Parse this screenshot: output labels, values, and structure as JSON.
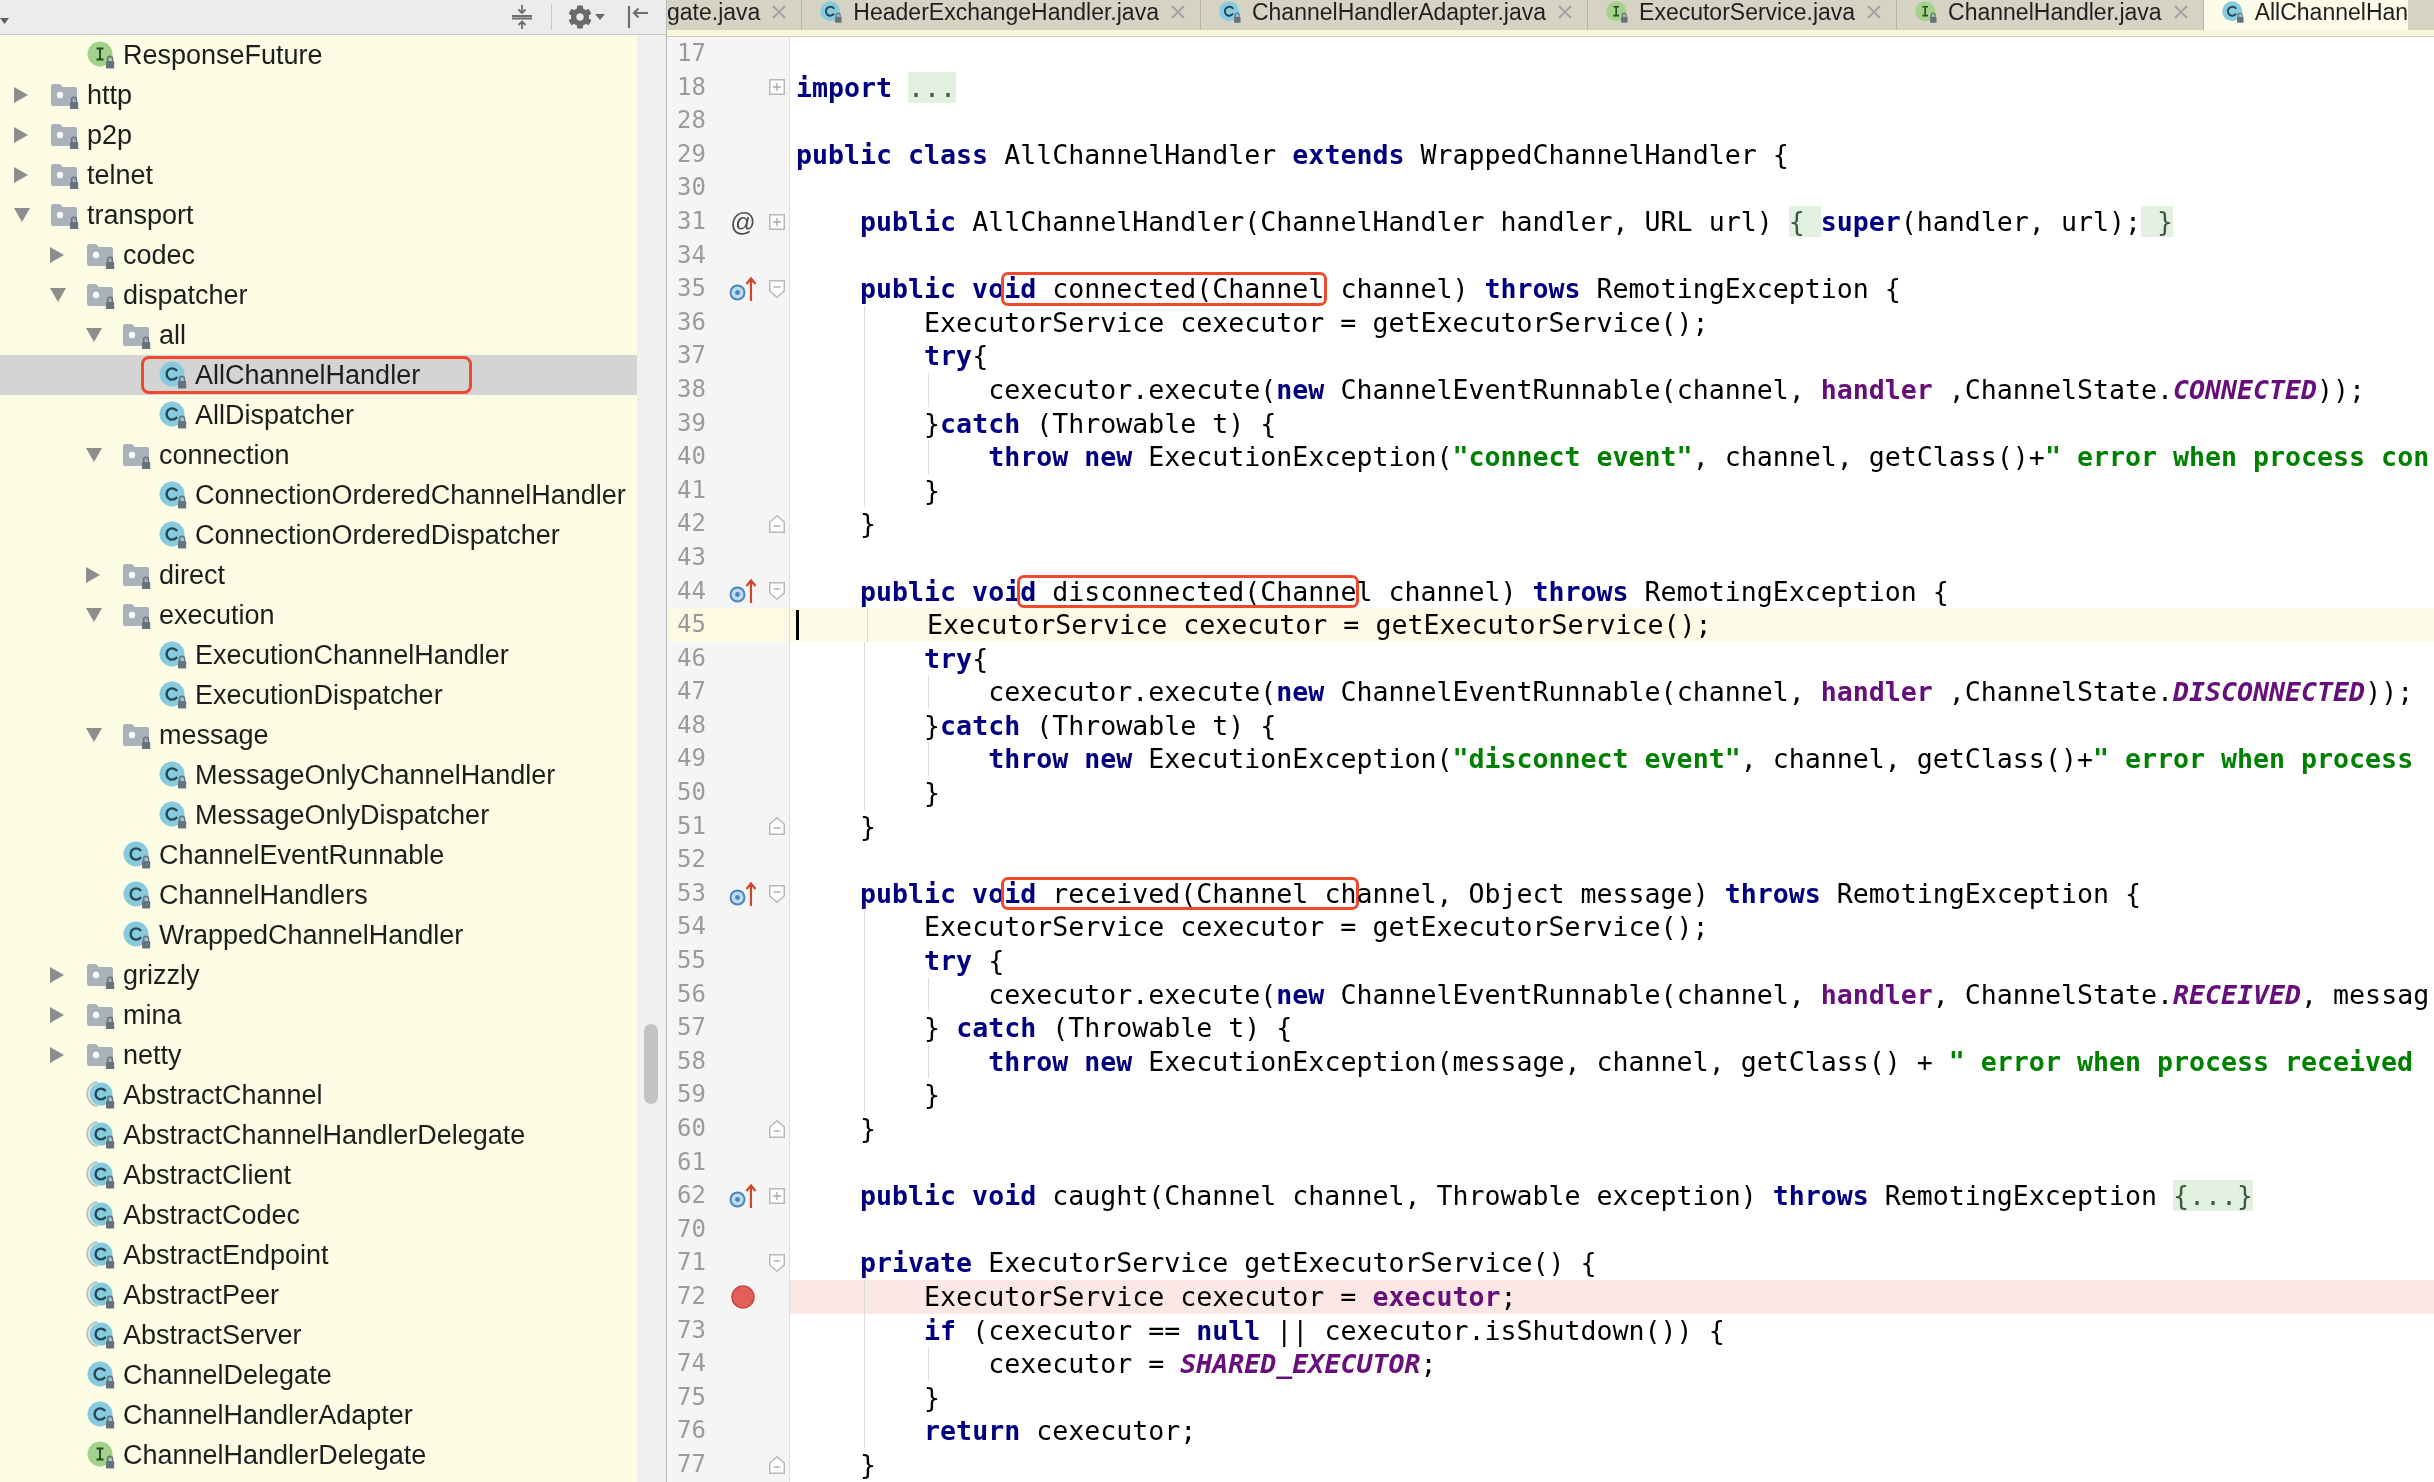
{
  "sidebar": {
    "tree": [
      {
        "children": [
          {
            "label": "ResponseFuture",
            "kind": "interface",
            "selected": false,
            "callout": false
          }
        ]
      },
      {
        "label": "http",
        "kind": "package",
        "expanded": false,
        "selected": false,
        "callout": false
      },
      {
        "label": "p2p",
        "kind": "package",
        "expanded": false,
        "selected": false,
        "callout": false
      },
      {
        "label": "telnet",
        "kind": "package",
        "expanded": false,
        "selected": false,
        "callout": false
      },
      {
        "label": "transport",
        "kind": "package",
        "expanded": true,
        "selected": false,
        "callout": false,
        "children": [
          {
            "label": "codec",
            "kind": "package",
            "expanded": false,
            "selected": false,
            "callout": false
          },
          {
            "label": "dispatcher",
            "kind": "package",
            "expanded": true,
            "selected": false,
            "callout": false,
            "children": [
              {
                "label": "all",
                "kind": "package",
                "expanded": true,
                "selected": false,
                "callout": false,
                "children": [
                  {
                    "label": "AllChannelHandler",
                    "kind": "class",
                    "selected": true,
                    "callout": true
                  },
                  {
                    "label": "AllDispatcher",
                    "kind": "class",
                    "selected": false,
                    "callout": false
                  }
                ]
              },
              {
                "label": "connection",
                "kind": "package",
                "expanded": true,
                "selected": false,
                "callout": false,
                "children": [
                  {
                    "label": "ConnectionOrderedChannelHandler",
                    "kind": "class",
                    "selected": false,
                    "callout": false
                  },
                  {
                    "label": "ConnectionOrderedDispatcher",
                    "kind": "class",
                    "selected": false,
                    "callout": false
                  }
                ]
              },
              {
                "label": "direct",
                "kind": "package",
                "expanded": false,
                "selected": false,
                "callout": false
              },
              {
                "label": "execution",
                "kind": "package",
                "expanded": true,
                "selected": false,
                "callout": false,
                "children": [
                  {
                    "label": "ExecutionChannelHandler",
                    "kind": "class",
                    "selected": false,
                    "callout": false
                  },
                  {
                    "label": "ExecutionDispatcher",
                    "kind": "class",
                    "selected": false,
                    "callout": false
                  }
                ]
              },
              {
                "label": "message",
                "kind": "package",
                "expanded": true,
                "selected": false,
                "callout": false,
                "children": [
                  {
                    "label": "MessageOnlyChannelHandler",
                    "kind": "class",
                    "selected": false,
                    "callout": false
                  },
                  {
                    "label": "MessageOnlyDispatcher",
                    "kind": "class",
                    "selected": false,
                    "callout": false
                  }
                ]
              },
              {
                "label": "ChannelEventRunnable",
                "kind": "class",
                "selected": false,
                "callout": false
              },
              {
                "label": "ChannelHandlers",
                "kind": "class",
                "selected": false,
                "callout": false
              },
              {
                "label": "WrappedChannelHandler",
                "kind": "class",
                "selected": false,
                "callout": false
              }
            ]
          },
          {
            "label": "grizzly",
            "kind": "package",
            "expanded": false,
            "selected": false,
            "callout": false
          },
          {
            "label": "mina",
            "kind": "package",
            "expanded": false,
            "selected": false,
            "callout": false
          },
          {
            "label": "netty",
            "kind": "package",
            "expanded": false,
            "selected": false,
            "callout": false
          },
          {
            "label": "AbstractChannel",
            "kind": "abstract_class",
            "selected": false,
            "callout": false
          },
          {
            "label": "AbstractChannelHandlerDelegate",
            "kind": "abstract_class",
            "selected": false,
            "callout": false
          },
          {
            "label": "AbstractClient",
            "kind": "abstract_class",
            "selected": false,
            "callout": false
          },
          {
            "label": "AbstractCodec",
            "kind": "abstract_class",
            "selected": false,
            "callout": false
          },
          {
            "label": "AbstractEndpoint",
            "kind": "abstract_class",
            "selected": false,
            "callout": false
          },
          {
            "label": "AbstractPeer",
            "kind": "abstract_class",
            "selected": false,
            "callout": false
          },
          {
            "label": "AbstractServer",
            "kind": "abstract_class",
            "selected": false,
            "callout": false
          },
          {
            "label": "ChannelDelegate",
            "kind": "class",
            "selected": false,
            "callout": false
          },
          {
            "label": "ChannelHandlerAdapter",
            "kind": "class",
            "selected": false,
            "callout": false
          },
          {
            "label": "ChannelHandlerDelegate",
            "kind": "interface",
            "selected": false,
            "callout": false
          }
        ]
      }
    ]
  },
  "editor": {
    "tabs": [
      {
        "label": "gate.java",
        "kind": "plain",
        "selected": false,
        "closable": true
      },
      {
        "label": "HeaderExchangeHandler.java",
        "kind": "class",
        "selected": false,
        "closable": true
      },
      {
        "label": "ChannelHandlerAdapter.java",
        "kind": "class",
        "selected": false,
        "closable": true
      },
      {
        "label": "ExecutorService.java",
        "kind": "interface",
        "selected": false,
        "closable": true
      },
      {
        "label": "ChannelHandler.java",
        "kind": "interface",
        "selected": false,
        "closable": true
      },
      {
        "label": "AllChannelHan",
        "kind": "class",
        "selected": true,
        "closable": false
      }
    ],
    "lines": [
      {
        "number": "17",
        "kind": "plain"
      },
      {
        "number": "18",
        "kind": "plain",
        "fold": {
          "kind": "collapsed"
        },
        "tokens": [
          {
            "text": "import ",
            "kind": "keyword"
          },
          {
            "text": "...",
            "kind": "fold"
          }
        ]
      },
      {
        "number": "28",
        "kind": "plain"
      },
      {
        "number": "29",
        "kind": "plain",
        "tokens": [
          {
            "text": "public class",
            "kind": "keyword"
          },
          {
            "text": " AllChannelHandler ",
            "kind": "plain"
          },
          {
            "text": "extends",
            "kind": "keyword"
          },
          {
            "text": " WrappedChannelHandler {",
            "kind": "plain"
          }
        ]
      },
      {
        "number": "30",
        "kind": "plain"
      },
      {
        "number": "31",
        "kind": "plain",
        "marker": {
          "kind": "glyph",
          "text": "@"
        },
        "fold": {
          "kind": "collapsed"
        },
        "tokens": [
          {
            "text": "    public",
            "kind": "keyword"
          },
          {
            "text": " AllChannelHandler(ChannelHandler handler, URL url) ",
            "kind": "plain"
          },
          {
            "text": "{ ",
            "kind": "fold"
          },
          {
            "text": "super",
            "kind": "keyword"
          },
          {
            "text": "(handler, url);",
            "kind": "plain"
          },
          {
            "text": " }",
            "kind": "fold"
          }
        ]
      },
      {
        "number": "34",
        "kind": "plain"
      },
      {
        "number": "35",
        "kind": "plain",
        "marker": {
          "kind": "override"
        },
        "fold": {
          "kind": "start"
        },
        "tokens": [
          {
            "text": "    public vo",
            "kind": "keyword"
          },
          {
            "kind": "callout",
            "parts": [
              {
                "text": "id",
                "kind": "keyword"
              },
              {
                "text": " connected(Channel",
                "kind": "plain"
              }
            ]
          },
          {
            "text": " channel) ",
            "kind": "plain"
          },
          {
            "text": "throws",
            "kind": "keyword"
          },
          {
            "text": " RemotingException {",
            "kind": "plain"
          }
        ]
      },
      {
        "number": "36",
        "kind": "plain",
        "tokens": [
          {
            "text": "        ExecutorService cexecutor = getExecutorService();",
            "kind": "plain"
          }
        ]
      },
      {
        "number": "37",
        "kind": "plain",
        "tokens": [
          {
            "text": "        try",
            "kind": "keyword"
          },
          {
            "text": "{",
            "kind": "plain"
          }
        ]
      },
      {
        "number": "38",
        "kind": "plain",
        "tokens": [
          {
            "text": "            cexecutor.execute(",
            "kind": "plain"
          },
          {
            "text": "new",
            "kind": "keyword"
          },
          {
            "text": " ChannelEventRunnable(channel, ",
            "kind": "plain"
          },
          {
            "text": "handler",
            "kind": "field"
          },
          {
            "text": " ,ChannelState.",
            "kind": "plain"
          },
          {
            "text": "CONNECTED",
            "kind": "constant"
          },
          {
            "text": "));",
            "kind": "plain"
          }
        ]
      },
      {
        "number": "39",
        "kind": "plain",
        "tokens": [
          {
            "text": "        }",
            "kind": "plain"
          },
          {
            "text": "catch",
            "kind": "keyword"
          },
          {
            "text": " (Throwable t) {",
            "kind": "plain"
          }
        ]
      },
      {
        "number": "40",
        "kind": "plain",
        "tokens": [
          {
            "text": "            throw new",
            "kind": "keyword"
          },
          {
            "text": " ExecutionException(",
            "kind": "plain"
          },
          {
            "text": "\"connect event\"",
            "kind": "string"
          },
          {
            "text": ", channel, getClass()+",
            "kind": "plain"
          },
          {
            "text": "\" error when process con",
            "kind": "string"
          }
        ]
      },
      {
        "number": "41",
        "kind": "plain",
        "tokens": [
          {
            "text": "        }",
            "kind": "plain"
          }
        ]
      },
      {
        "number": "42",
        "kind": "plain",
        "fold": {
          "kind": "end"
        },
        "tokens": [
          {
            "text": "    }",
            "kind": "plain"
          }
        ]
      },
      {
        "number": "43",
        "kind": "plain"
      },
      {
        "number": "44",
        "kind": "plain",
        "marker": {
          "kind": "override"
        },
        "fold": {
          "kind": "start"
        },
        "tokens": [
          {
            "text": "    public voi",
            "kind": "keyword"
          },
          {
            "kind": "callout",
            "parts": [
              {
                "text": "d",
                "kind": "keyword"
              },
              {
                "text": " disconnected(Channe",
                "kind": "plain"
              }
            ]
          },
          {
            "text": "l channel) ",
            "kind": "plain"
          },
          {
            "text": "throws",
            "kind": "keyword"
          },
          {
            "text": " RemotingException {",
            "kind": "plain"
          }
        ]
      },
      {
        "number": "45",
        "kind": "current",
        "tokens": [
          {
            "text": "        ExecutorService cexecutor = getExecutorService();",
            "kind": "plain"
          }
        ]
      },
      {
        "number": "46",
        "kind": "plain",
        "tokens": [
          {
            "text": "        try",
            "kind": "keyword"
          },
          {
            "text": "{",
            "kind": "plain"
          }
        ]
      },
      {
        "number": "47",
        "kind": "plain",
        "tokens": [
          {
            "text": "            cexecutor.execute(",
            "kind": "plain"
          },
          {
            "text": "new",
            "kind": "keyword"
          },
          {
            "text": " ChannelEventRunnable(channel, ",
            "kind": "plain"
          },
          {
            "text": "handler",
            "kind": "field"
          },
          {
            "text": " ,ChannelState.",
            "kind": "plain"
          },
          {
            "text": "DISCONNECTED",
            "kind": "constant"
          },
          {
            "text": "));",
            "kind": "plain"
          }
        ]
      },
      {
        "number": "48",
        "kind": "plain",
        "tokens": [
          {
            "text": "        }",
            "kind": "plain"
          },
          {
            "text": "catch",
            "kind": "keyword"
          },
          {
            "text": " (Throwable t) {",
            "kind": "plain"
          }
        ]
      },
      {
        "number": "49",
        "kind": "plain",
        "tokens": [
          {
            "text": "            throw new",
            "kind": "keyword"
          },
          {
            "text": " ExecutionException(",
            "kind": "plain"
          },
          {
            "text": "\"disconnect event\"",
            "kind": "string"
          },
          {
            "text": ", channel, getClass()+",
            "kind": "plain"
          },
          {
            "text": "\" error when process",
            "kind": "string"
          }
        ]
      },
      {
        "number": "50",
        "kind": "plain",
        "tokens": [
          {
            "text": "        }",
            "kind": "plain"
          }
        ]
      },
      {
        "number": "51",
        "kind": "plain",
        "fold": {
          "kind": "end"
        },
        "tokens": [
          {
            "text": "    }",
            "kind": "plain"
          }
        ]
      },
      {
        "number": "52",
        "kind": "plain"
      },
      {
        "number": "53",
        "kind": "plain",
        "marker": {
          "kind": "override"
        },
        "fold": {
          "kind": "start"
        },
        "tokens": [
          {
            "text": "    public vo",
            "kind": "keyword"
          },
          {
            "kind": "callout",
            "parts": [
              {
                "text": "id",
                "kind": "keyword"
              },
              {
                "text": " received(Channel ch",
                "kind": "plain"
              }
            ]
          },
          {
            "text": "annel, Object message) ",
            "kind": "plain"
          },
          {
            "text": "throws",
            "kind": "keyword"
          },
          {
            "text": " RemotingException {",
            "kind": "plain"
          }
        ]
      },
      {
        "number": "54",
        "kind": "plain",
        "tokens": [
          {
            "text": "        ExecutorService cexecutor = getExecutorService();",
            "kind": "plain"
          }
        ]
      },
      {
        "number": "55",
        "kind": "plain",
        "tokens": [
          {
            "text": "        try",
            "kind": "keyword"
          },
          {
            "text": " {",
            "kind": "plain"
          }
        ]
      },
      {
        "number": "56",
        "kind": "plain",
        "tokens": [
          {
            "text": "            cexecutor.execute(",
            "kind": "plain"
          },
          {
            "text": "new",
            "kind": "keyword"
          },
          {
            "text": " ChannelEventRunnable(channel, ",
            "kind": "plain"
          },
          {
            "text": "handler",
            "kind": "field"
          },
          {
            "text": ", ChannelState.",
            "kind": "plain"
          },
          {
            "text": "RECEIVED",
            "kind": "constant"
          },
          {
            "text": ", messag",
            "kind": "plain"
          }
        ]
      },
      {
        "number": "57",
        "kind": "plain",
        "tokens": [
          {
            "text": "        } ",
            "kind": "plain"
          },
          {
            "text": "catch",
            "kind": "keyword"
          },
          {
            "text": " (Throwable t) {",
            "kind": "plain"
          }
        ]
      },
      {
        "number": "58",
        "kind": "plain",
        "tokens": [
          {
            "text": "            throw new",
            "kind": "keyword"
          },
          {
            "text": " ExecutionException(message, channel, getClass() + ",
            "kind": "plain"
          },
          {
            "text": "\" error when process received",
            "kind": "string"
          }
        ]
      },
      {
        "number": "59",
        "kind": "plain",
        "tokens": [
          {
            "text": "        }",
            "kind": "plain"
          }
        ]
      },
      {
        "number": "60",
        "kind": "plain",
        "fold": {
          "kind": "end"
        },
        "tokens": [
          {
            "text": "    }",
            "kind": "plain"
          }
        ]
      },
      {
        "number": "61",
        "kind": "plain"
      },
      {
        "number": "62",
        "kind": "plain",
        "marker": {
          "kind": "override"
        },
        "fold": {
          "kind": "collapsed"
        },
        "tokens": [
          {
            "text": "    public void",
            "kind": "keyword"
          },
          {
            "text": " caught(Channel channel, Throwable exception) ",
            "kind": "plain"
          },
          {
            "text": "throws",
            "kind": "keyword"
          },
          {
            "text": " RemotingException ",
            "kind": "plain"
          },
          {
            "text": "{...}",
            "kind": "fold"
          }
        ]
      },
      {
        "number": "70",
        "kind": "plain"
      },
      {
        "number": "71",
        "kind": "plain",
        "fold": {
          "kind": "start"
        },
        "tokens": [
          {
            "text": "    private",
            "kind": "keyword"
          },
          {
            "text": " ExecutorService getExecutorService() {",
            "kind": "plain"
          }
        ]
      },
      {
        "number": "72",
        "kind": "breakpoint",
        "tokens": [
          {
            "text": "        ExecutorService cexecutor = ",
            "kind": "plain"
          },
          {
            "text": "executor",
            "kind": "field"
          },
          {
            "text": ";",
            "kind": "plain"
          }
        ]
      },
      {
        "number": "73",
        "kind": "plain",
        "tokens": [
          {
            "text": "        if",
            "kind": "keyword"
          },
          {
            "text": " (cexecutor == ",
            "kind": "plain"
          },
          {
            "text": "null",
            "kind": "keyword"
          },
          {
            "text": " || cexecutor.isShutdown()) {",
            "kind": "plain"
          }
        ]
      },
      {
        "number": "74",
        "kind": "plain",
        "tokens": [
          {
            "text": "            cexecutor = ",
            "kind": "plain"
          },
          {
            "text": "SHARED_EXECUTOR",
            "kind": "constant"
          },
          {
            "text": ";",
            "kind": "plain"
          }
        ]
      },
      {
        "number": "75",
        "kind": "plain",
        "tokens": [
          {
            "text": "        }",
            "kind": "plain"
          }
        ]
      },
      {
        "number": "76",
        "kind": "plain",
        "tokens": [
          {
            "text": "        return",
            "kind": "keyword"
          },
          {
            "text": " cexecutor;",
            "kind": "plain"
          }
        ]
      },
      {
        "number": "77",
        "kind": "plain",
        "fold": {
          "kind": "end"
        },
        "tokens": [
          {
            "text": "    }",
            "kind": "plain"
          }
        ]
      }
    ]
  }
}
